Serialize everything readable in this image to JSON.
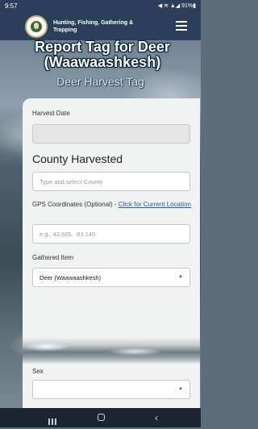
{
  "status_bar": {
    "time": "9:57",
    "indicators": "◀ ≋ ▲◢ 91%▮"
  },
  "app_bar": {
    "title": "Hunting, Fishing, Gathering & Trapping"
  },
  "page": {
    "title": "Report Tag for Deer (Waawaashkesh)",
    "subtitle": "Deer Harvest Tag"
  },
  "form": {
    "harvest_date": {
      "label": "Harvest Date",
      "value": ""
    },
    "county": {
      "heading": "County Harvested",
      "placeholder": "Type and select County"
    },
    "gps": {
      "label": "GPS Coordinates (Optional) - ",
      "link": "Click for Current Location",
      "placeholder": "e.g., 42.605, -83.145"
    },
    "gathered_item": {
      "label": "Gathered Item",
      "value": "Deer (Waawaashkesh)"
    },
    "sex": {
      "label": "Sex",
      "value": ""
    }
  },
  "colors": {
    "app_bar": "#2b3f5d",
    "card": "#f1f2f2",
    "link": "#2b5b9a"
  }
}
